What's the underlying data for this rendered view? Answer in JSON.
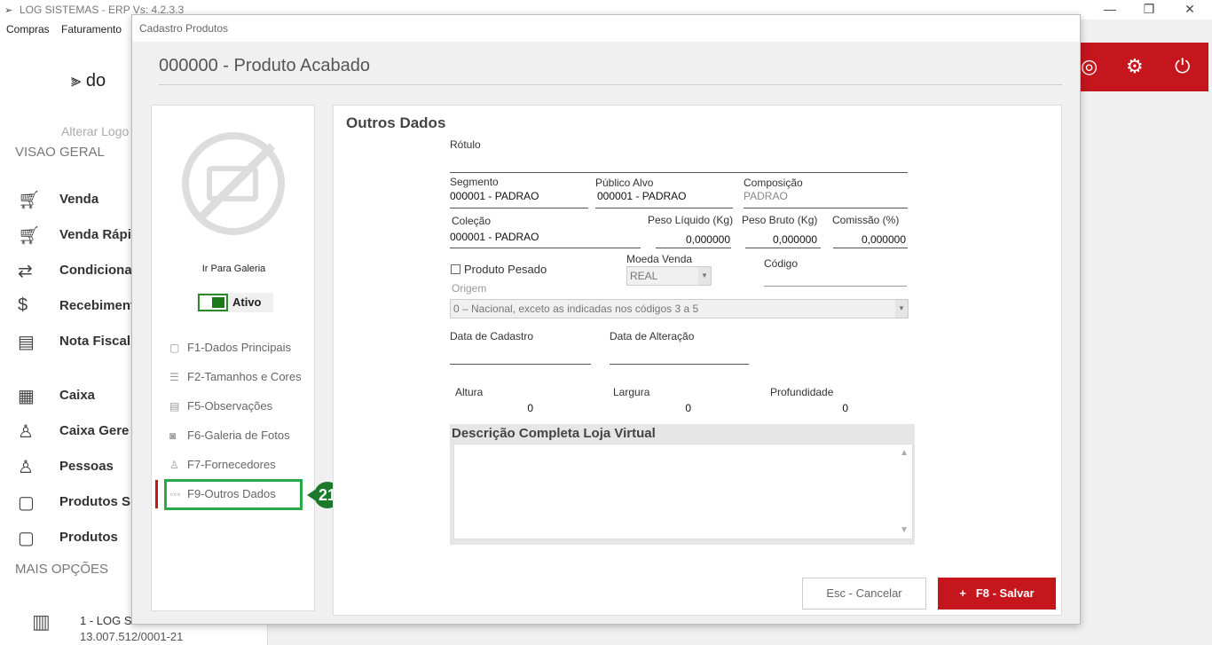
{
  "app": {
    "window_title": "LOG SISTEMAS - ERP Vs: 4.2.3.3",
    "menu": [
      "Compras",
      "Faturamento"
    ],
    "brand_text": "do",
    "alterar_logo": "Alterar Logo"
  },
  "sidebar": {
    "section_visao": "VISAO GERAL",
    "section_mais": "MAIS OPÇÕES",
    "items": [
      {
        "label": "Venda",
        "icon": "cart-icon"
      },
      {
        "label": "Venda Rápi",
        "icon": "cart-icon"
      },
      {
        "label": "Condicional",
        "icon": "cart-arrows-icon"
      },
      {
        "label": "Recebiment",
        "icon": "money-hand-icon"
      },
      {
        "label": "Nota Fiscal",
        "icon": "nfe-icon"
      },
      {
        "label": "Caixa",
        "icon": "cash-register-icon"
      },
      {
        "label": "Caixa Gere",
        "icon": "user-money-icon"
      },
      {
        "label": "Pessoas",
        "icon": "person-list-icon"
      },
      {
        "label": "Produtos Si",
        "icon": "box-icon"
      },
      {
        "label": "Produtos",
        "icon": "box-icon"
      }
    ],
    "company_name": "1 - LOG S",
    "company_cnpj": "13.007.512/0001-21"
  },
  "dialog": {
    "title": "Cadastro Produtos",
    "product_title": "000000 - Produto Acabado",
    "galeria": "Ir Para Galeria",
    "status": "Ativo",
    "status_on": true,
    "menu": [
      {
        "label": "F1-Dados Principais",
        "icon": "doc-icon"
      },
      {
        "label": "F2-Tamanhos  e Cores",
        "icon": "list-icon"
      },
      {
        "label": "F5-Observações",
        "icon": "notes-icon"
      },
      {
        "label": "F6-Galeria de Fotos",
        "icon": "camera-icon"
      },
      {
        "label": "F7-Fornecedores",
        "icon": "supplier-icon"
      },
      {
        "label": "F9-Outros Dados",
        "icon": "dots-icon"
      }
    ],
    "annotation_badge": "21"
  },
  "form": {
    "section_title": "Outros Dados",
    "rotulo_label": "Rótulo",
    "rotulo_value": "",
    "segmento_label": "Segmento",
    "segmento_value": "000001 - PADRAO",
    "publico_label": "Público Alvo",
    "publico_value": "000001 - PADRAO",
    "composicao_label": "Composição",
    "composicao_value": "PADRAO",
    "colecao_label": "Coleção",
    "colecao_value": "000001 - PADRAO",
    "peso_liquido_label": "Peso Líquido (Kg)",
    "peso_liquido_value": "0,000000",
    "peso_bruto_label": "Peso Bruto (Kg)",
    "peso_bruto_value": "0,000000",
    "comissao_label": "Comissão (%)",
    "comissao_value": "0,000000",
    "produto_pesado_label": "Produto Pesado",
    "moeda_label": "Moeda Venda",
    "moeda_value": "REAL",
    "codigo_label": "Código",
    "origem_label": "Origem",
    "origem_value": "0 – Nacional, exceto as indicadas nos códigos 3 a 5",
    "data_cadastro_label": "Data de Cadastro",
    "data_alteracao_label": "Data de Alteração",
    "altura_label": "Altura",
    "altura_value": "0",
    "largura_label": "Largura",
    "largura_value": "0",
    "profundidade_label": "Profundidade",
    "profundidade_value": "0",
    "descricao_label": "Descrição Completa Loja Virtual",
    "descricao_value": ""
  },
  "buttons": {
    "cancel": "Esc - Cancelar",
    "save": "F8 - Salvar",
    "save_icon": "+"
  },
  "colors": {
    "accent_red": "#c4161c",
    "highlight_green": "#2aa84a",
    "toggle_green": "#1a7a1a"
  }
}
